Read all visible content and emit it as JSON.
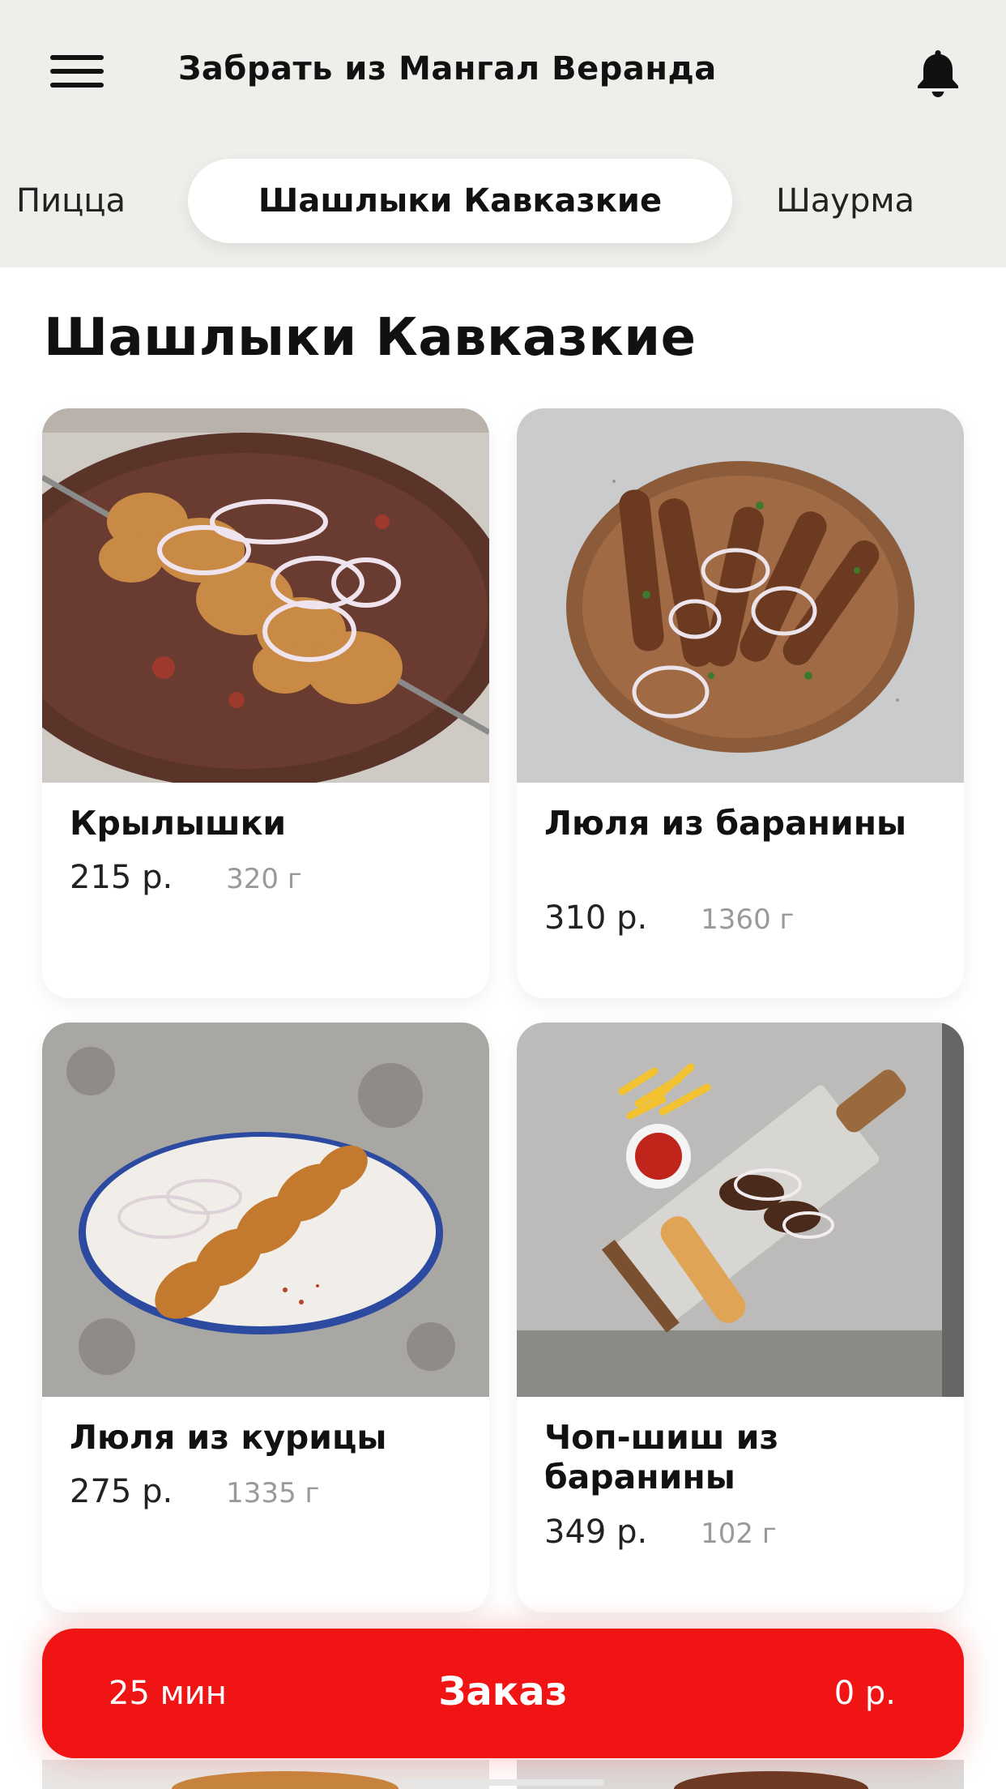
{
  "header": {
    "menu_icon": "hamburger-menu-icon",
    "title": "Забрать из Мангал Веранда",
    "bell_icon": "bell-icon"
  },
  "tabs": [
    {
      "label": "Пицца",
      "active": false
    },
    {
      "label": "Шашлыки Кавказкие",
      "active": true
    },
    {
      "label": "Шаурма",
      "active": false
    }
  ],
  "section": {
    "title": "Шашлыки Кавказкие"
  },
  "products": [
    {
      "name": "Крылышки",
      "price": "215 р.",
      "weight": "320 г",
      "image": "chicken-wings-photo"
    },
    {
      "name": "Люля из баранины",
      "price": "310 р.",
      "weight": "1360 г",
      "image": "lamb-lula-photo"
    },
    {
      "name": "Люля из курицы",
      "price": "275 р.",
      "weight": "1335 г",
      "image": "chicken-lula-photo"
    },
    {
      "name": "Чоп-шиш из баранины",
      "price": "349 р.",
      "weight": "102 г",
      "image": "lamb-chop-shish-photo"
    }
  ],
  "order_bar": {
    "time": "25 мин",
    "label": "Заказ",
    "total": "0 р."
  },
  "colors": {
    "accent": "#f01414",
    "header_bg": "#f0eeea"
  }
}
